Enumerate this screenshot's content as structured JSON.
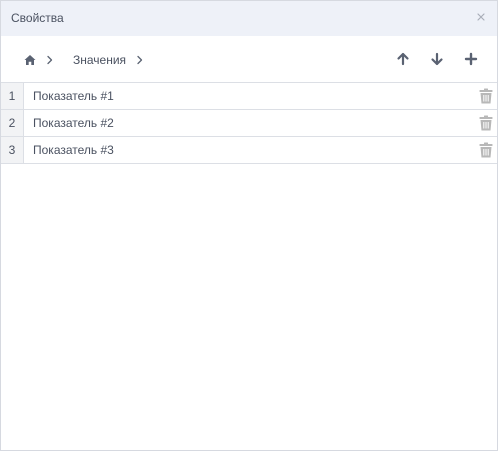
{
  "dialog": {
    "title": "Свойства",
    "close_icon": "close-icon"
  },
  "toolbar": {
    "breadcrumb": {
      "home_icon": "home-icon",
      "separator_icon": "chevron-right-icon",
      "items": [
        {
          "label": "Значения"
        }
      ]
    },
    "buttons": [
      {
        "name": "move-up",
        "icon": "arrow-up-icon"
      },
      {
        "name": "move-down",
        "icon": "arrow-down-icon"
      },
      {
        "name": "add",
        "icon": "plus-icon"
      }
    ]
  },
  "rows": [
    {
      "index": "1",
      "label": "Показатель #1",
      "delete_icon": "trash-icon"
    },
    {
      "index": "2",
      "label": "Показатель #2",
      "delete_icon": "trash-icon"
    },
    {
      "index": "3",
      "label": "Показатель #3",
      "delete_icon": "trash-icon"
    }
  ],
  "colors": {
    "titlebar_bg": "#eef1f8",
    "text": "#4a5160",
    "icon": "#5a6272",
    "trash": "#b8b8b8",
    "border": "#dcdfe5",
    "index_bg": "#f2f3f5"
  }
}
